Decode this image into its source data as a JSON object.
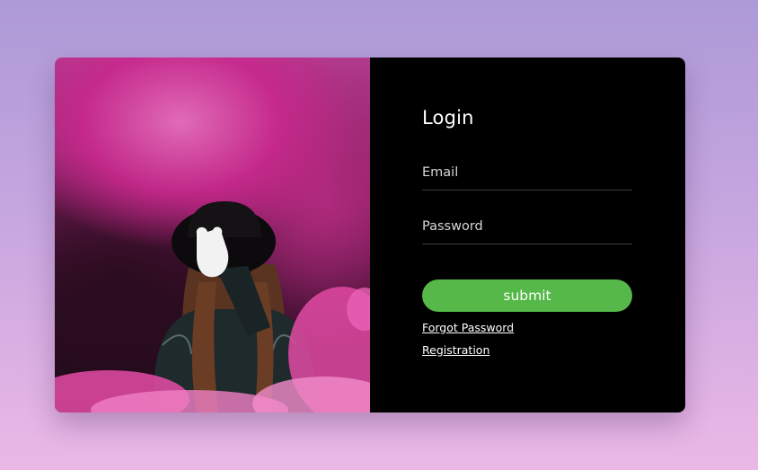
{
  "login": {
    "title": "Login",
    "email_placeholder": "Email",
    "password_placeholder": "Password",
    "submit_label": "submit",
    "forgot_password_label": "Forgot Password",
    "registration_label": "Registration"
  },
  "colors": {
    "background_top": "#ad9ad7",
    "background_bottom": "#ebb8e6",
    "panel": "#000000",
    "submit_button": "#55b848",
    "text": "#ffffff"
  }
}
